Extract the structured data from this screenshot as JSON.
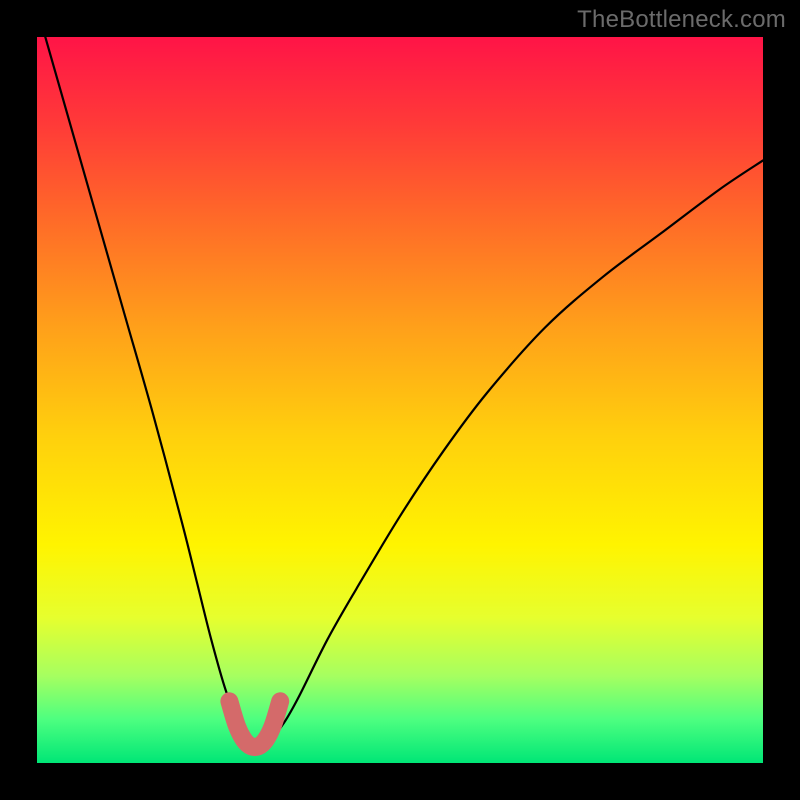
{
  "watermark": "TheBottleneck.com",
  "colors": {
    "page_bg": "#000000",
    "curve": "#000000",
    "highlight": "#d46a6a",
    "gradient_top": "#ff1447",
    "gradient_bottom": "#00e676"
  },
  "chart_data": {
    "type": "line",
    "title": "",
    "xlabel": "",
    "ylabel": "",
    "xlim": [
      0,
      100
    ],
    "ylim": [
      0,
      100
    ],
    "grid": false,
    "series": [
      {
        "name": "bottleneck-curve",
        "x": [
          0,
          4,
          8,
          12,
          16,
          20,
          22,
          24,
          26,
          28,
          29,
          30,
          31,
          32,
          34,
          36,
          40,
          44,
          50,
          56,
          62,
          70,
          78,
          86,
          94,
          100
        ],
        "y": [
          104,
          90,
          76,
          62,
          48,
          33,
          25,
          17,
          10,
          5,
          3,
          2.3,
          2.3,
          3,
          5.5,
          9,
          17,
          24,
          34,
          43,
          51,
          60,
          67,
          73,
          79,
          83
        ]
      }
    ],
    "highlight": {
      "name": "minimum-zone",
      "x": [
        26.5,
        27.5,
        28.5,
        29.5,
        30.5,
        31.5,
        32.5,
        33.5
      ],
      "y": [
        8.5,
        5.2,
        3.2,
        2.3,
        2.3,
        3.2,
        5.2,
        8.5
      ]
    }
  }
}
